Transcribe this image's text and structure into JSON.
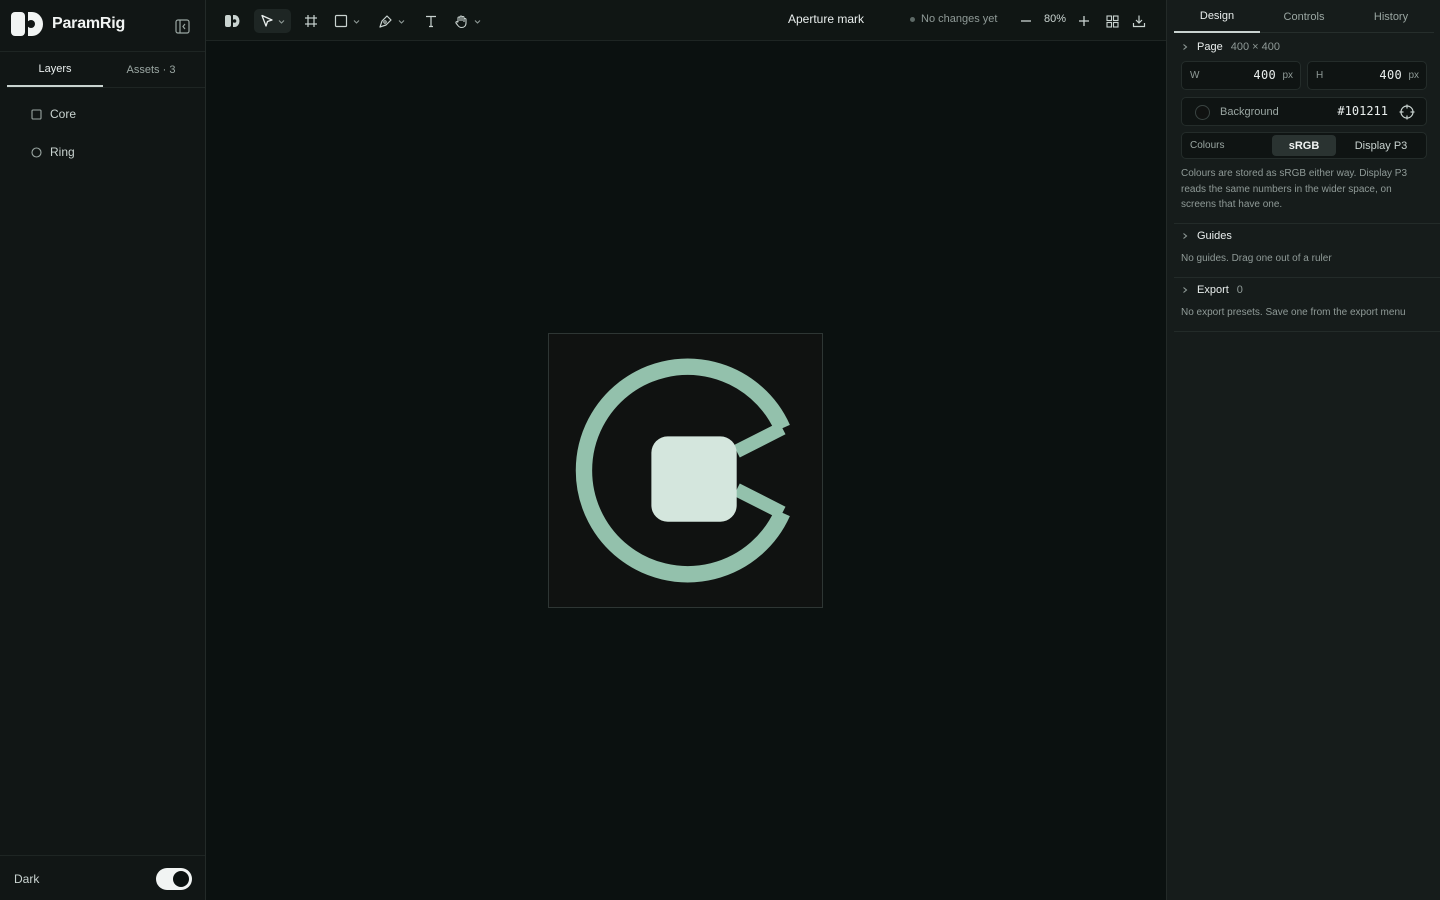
{
  "app": {
    "name": "ParamRig",
    "document_title": "Aperture mark",
    "status": "No changes yet"
  },
  "sidebar": {
    "tabs": [
      {
        "label": "Layers",
        "active": true
      },
      {
        "label": "Assets · 3",
        "active": false
      }
    ],
    "layers": [
      {
        "label": "Core",
        "icon": "square-icon"
      },
      {
        "label": "Ring",
        "icon": "circle-icon"
      }
    ],
    "footer": {
      "dark_label": "Dark",
      "dark_enabled": true
    }
  },
  "toolbar": {
    "tools": [
      "logo-icon",
      "select-tool",
      "frame-tool",
      "rectangle-tool",
      "pen-tool",
      "text-tool",
      "hand-tool"
    ],
    "zoom": "80%"
  },
  "panel": {
    "tabs": [
      {
        "label": "Design",
        "active": true
      },
      {
        "label": "Controls",
        "active": false
      },
      {
        "label": "History",
        "active": false
      }
    ],
    "page": {
      "label": "Page",
      "size": "400 × 400",
      "width_label": "W",
      "width": "400",
      "height_label": "H",
      "height": "400",
      "unit": "px"
    },
    "background": {
      "label": "Background",
      "value": "#101211"
    },
    "colours": {
      "label": "Colours",
      "options": [
        "sRGB",
        "Display P3"
      ],
      "selected": "sRGB",
      "help": "Colours are stored as sRGB either way. Display P3 reads the same numbers in the wider space, on screens that have one."
    },
    "guides": {
      "label": "Guides",
      "help": "No guides. Drag one out of a ruler"
    },
    "export": {
      "label": "Export",
      "count": "0",
      "help": "No export presets. Save one from the export menu"
    }
  },
  "artwork": {
    "ring_color": "#93c1ac",
    "core_color": "#d4e6dd",
    "background": "#101211"
  }
}
